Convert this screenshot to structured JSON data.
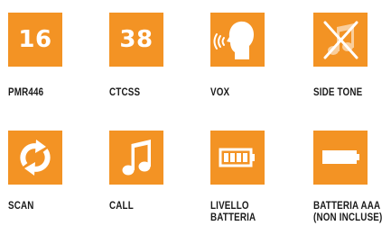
{
  "colors": {
    "tile": "#f39324",
    "glyph": "#ffffff",
    "label": "#1a1a1a"
  },
  "features": [
    {
      "value": "16",
      "label": "PMR446"
    },
    {
      "value": "38",
      "label": "CTCSS"
    },
    {
      "icon": "voice-activation-head-icon",
      "label": "VOX"
    },
    {
      "icon": "muted-note-icon",
      "label": "SIDE TONE"
    },
    {
      "icon": "scan-arrows-icon",
      "label": "SCAN"
    },
    {
      "icon": "music-note-icon",
      "label": "CALL"
    },
    {
      "icon": "battery-level-icon",
      "label_line1": "LIVELLO",
      "label_line2": "BATTERIA"
    },
    {
      "icon": "aaa-battery-icon",
      "label_line1": "BATTERIA AAA",
      "label_line2": "(NON INCLUSE)"
    }
  ]
}
